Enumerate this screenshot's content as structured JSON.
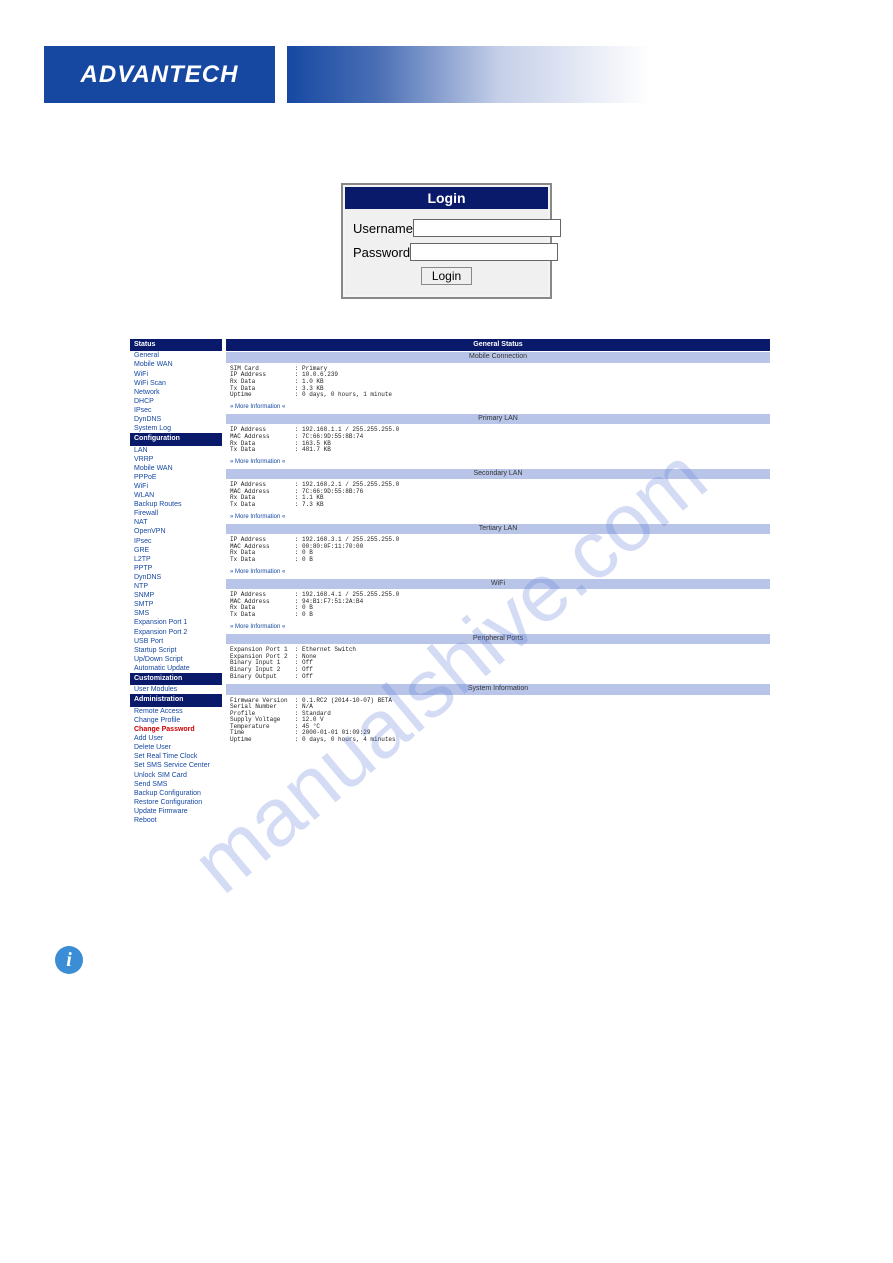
{
  "brand": "ADVANTECH",
  "login": {
    "title": "Login",
    "username_label": "Username",
    "password_label": "Password",
    "button": "Login"
  },
  "sidebar": {
    "status": {
      "title": "Status",
      "items": [
        "General",
        "Mobile WAN",
        "WiFi",
        "WiFi Scan",
        "Network",
        "DHCP",
        "IPsec",
        "DynDNS",
        "System Log"
      ]
    },
    "config": {
      "title": "Configuration",
      "items": [
        "LAN",
        "VRRP",
        "Mobile WAN",
        "PPPoE",
        "WiFi",
        "WLAN",
        "Backup Routes",
        "Firewall",
        "NAT",
        "OpenVPN",
        "IPsec",
        "GRE",
        "L2TP",
        "PPTP",
        "DynDNS",
        "NTP",
        "SNMP",
        "SMTP",
        "SMS",
        "Expansion Port 1",
        "Expansion Port 2",
        "USB Port",
        "Startup Script",
        "Up/Down Script",
        "Automatic Update"
      ]
    },
    "custom": {
      "title": "Customization",
      "items": [
        "User Modules"
      ]
    },
    "admin": {
      "title": "Administration",
      "items": [
        "Remote Access",
        "Change Profile",
        "Change Password",
        "Add User",
        "Delete User",
        "Set Real Time Clock",
        "Set SMS Service Center",
        "Unlock SIM Card",
        "Send SMS",
        "Backup Configuration",
        "Restore Configuration",
        "Update Firmware",
        "Reboot"
      ],
      "active": "Change Password"
    }
  },
  "main": {
    "title": "General Status",
    "more": "» More Information «",
    "sections": [
      {
        "title": "Mobile Connection",
        "rows": [
          [
            "SIM Card",
            "Primary"
          ],
          [
            "IP Address",
            "10.0.6.239"
          ],
          [
            "Rx Data",
            "1.0 KB"
          ],
          [
            "Tx Data",
            "3.3 KB"
          ],
          [
            "Uptime",
            "0 days, 0 hours, 1 minute"
          ]
        ],
        "more": true
      },
      {
        "title": "Primary LAN",
        "rows": [
          [
            "IP Address",
            "192.168.1.1 / 255.255.255.0"
          ],
          [
            "MAC Address",
            "7C:66:9D:55:8B:74"
          ],
          [
            "Rx Data",
            "163.5 KB"
          ],
          [
            "Tx Data",
            "481.7 KB"
          ]
        ],
        "more": true
      },
      {
        "title": "Secondary LAN",
        "rows": [
          [
            "IP Address",
            "192.168.2.1 / 255.255.255.0"
          ],
          [
            "MAC Address",
            "7C:66:9D:55:8B:76"
          ],
          [
            "Rx Data",
            "1.1 KB"
          ],
          [
            "Tx Data",
            "7.3 KB"
          ]
        ],
        "more": true
      },
      {
        "title": "Tertiary LAN",
        "rows": [
          [
            "IP Address",
            "192.168.3.1 / 255.255.255.0"
          ],
          [
            "MAC Address",
            "00:80:0F:11:70:00"
          ],
          [
            "Rx Data",
            "0 B"
          ],
          [
            "Tx Data",
            "0 B"
          ]
        ],
        "more": true
      },
      {
        "title": "WiFi",
        "rows": [
          [
            "IP Address",
            "192.168.4.1 / 255.255.255.0"
          ],
          [
            "MAC Address",
            "94:B1:F7:51:2A:B4"
          ],
          [
            "Rx Data",
            "0 B"
          ],
          [
            "Tx Data",
            "0 B"
          ]
        ],
        "more": true
      },
      {
        "title": "Peripheral Ports",
        "rows": [
          [
            "Expansion Port 1",
            "Ethernet Switch"
          ],
          [
            "Expansion Port 2",
            "None"
          ],
          [
            "Binary Input 1",
            "Off"
          ],
          [
            "Binary Input 2",
            "Off"
          ],
          [
            "Binary Output",
            "Off"
          ]
        ],
        "more": false
      },
      {
        "title": "System Information",
        "rows": [
          [
            "Firmware Version",
            "0.1.RC2 (2014-10-07) BETA"
          ],
          [
            "Serial Number",
            "N/A"
          ],
          [
            "Profile",
            "Standard"
          ],
          [
            "Supply Voltage",
            "12.0 V"
          ],
          [
            "Temperature",
            "45 °C"
          ],
          [
            "Time",
            "2000-01-01 01:09:29"
          ],
          [
            "Uptime",
            "0 days, 0 hours, 4 minutes"
          ]
        ],
        "more": false
      }
    ]
  },
  "watermark": "manualshive.com"
}
